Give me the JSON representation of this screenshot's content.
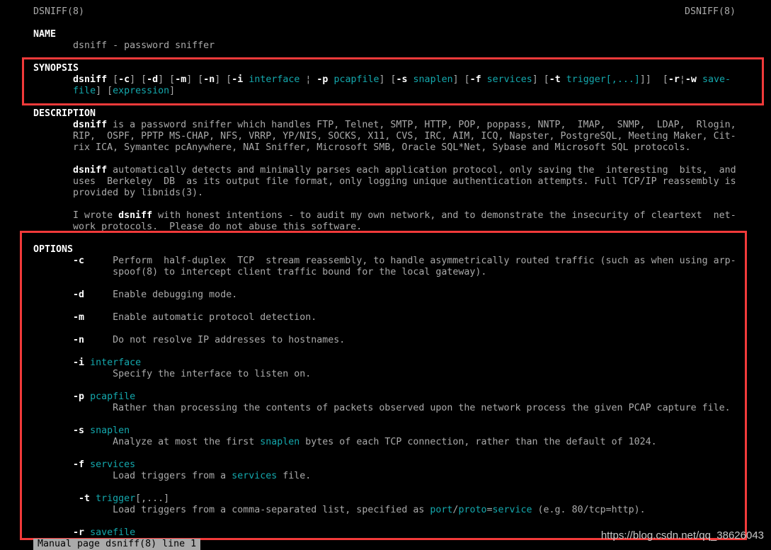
{
  "header": {
    "left": "DSNIFF(8)",
    "right": "DSNIFF(8)"
  },
  "colors": {
    "bold": "#ffffff",
    "normal": "#aaaaaa",
    "underline_cyan": "#14a8ad",
    "highlight_box": "#f23a3a",
    "status_bg": "#aaaaaa"
  },
  "lines": [
    [],
    [
      [
        "b",
        "NAME"
      ]
    ],
    [
      [
        "n",
        "       dsniff - password sniffer"
      ]
    ],
    [],
    [
      [
        "b",
        "SYNOPSIS"
      ]
    ],
    [
      [
        "b",
        "       dsniff"
      ],
      [
        "n",
        " ["
      ],
      [
        "b",
        "-c"
      ],
      [
        "n",
        "] ["
      ],
      [
        "b",
        "-d"
      ],
      [
        "n",
        "] ["
      ],
      [
        "b",
        "-m"
      ],
      [
        "n",
        "] ["
      ],
      [
        "b",
        "-n"
      ],
      [
        "n",
        "] ["
      ],
      [
        "b",
        "-i"
      ],
      [
        "n",
        " "
      ],
      [
        "c",
        "interface"
      ],
      [
        "n",
        " ¦ "
      ],
      [
        "b",
        "-p"
      ],
      [
        "n",
        " "
      ],
      [
        "c",
        "pcapfile"
      ],
      [
        "n",
        "] ["
      ],
      [
        "b",
        "-s"
      ],
      [
        "n",
        " "
      ],
      [
        "c",
        "snaplen"
      ],
      [
        "n",
        "] ["
      ],
      [
        "b",
        "-f"
      ],
      [
        "n",
        " "
      ],
      [
        "c",
        "services"
      ],
      [
        "n",
        "] ["
      ],
      [
        "b",
        "-t"
      ],
      [
        "n",
        " "
      ],
      [
        "c",
        "trigger[,...]"
      ],
      [
        "n",
        "]]  ["
      ],
      [
        "b",
        "-r"
      ],
      [
        "n",
        "¦"
      ],
      [
        "b",
        "-w"
      ],
      [
        "n",
        " "
      ],
      [
        "c",
        "save-"
      ]
    ],
    [
      [
        "n",
        "       "
      ],
      [
        "c",
        "file"
      ],
      [
        "n",
        "] ["
      ],
      [
        "c",
        "expression"
      ],
      [
        "n",
        "]"
      ]
    ],
    [],
    [
      [
        "b",
        "DESCRIPTION"
      ]
    ],
    [
      [
        "b",
        "       dsniff"
      ],
      [
        "n",
        " is a password sniffer which handles FTP, Telnet, SMTP, HTTP, POP, poppass, NNTP,  IMAP,  SNMP,  LDAP,  Rlogin,"
      ]
    ],
    [
      [
        "n",
        "       RIP,  OSPF, PPTP MS-CHAP, NFS, VRRP, YP/NIS, SOCKS, X11, CVS, IRC, AIM, ICQ, Napster, PostgreSQL, Meeting Maker, Cit-"
      ]
    ],
    [
      [
        "n",
        "       rix ICA, Symantec pcAnywhere, NAI Sniffer, Microsoft SMB, Oracle SQL*Net, Sybase and Microsoft SQL protocols."
      ]
    ],
    [],
    [
      [
        "b",
        "       dsniff"
      ],
      [
        "n",
        " automatically detects and minimally parses each application protocol, only saving the  interesting  bits,  and"
      ]
    ],
    [
      [
        "n",
        "       uses  Berkeley  DB  as its output file format, only logging unique authentication attempts. Full TCP/IP reassembly is"
      ]
    ],
    [
      [
        "n",
        "       provided by libnids(3)."
      ]
    ],
    [],
    [
      [
        "n",
        "       I wrote "
      ],
      [
        "b",
        "dsniff"
      ],
      [
        "n",
        " with honest intentions - to audit my own network, and to demonstrate the insecurity of cleartext  net-"
      ]
    ],
    [
      [
        "n",
        "       work protocols.  Please do not abuse this software."
      ]
    ],
    [],
    [
      [
        "b",
        "OPTIONS"
      ]
    ],
    [
      [
        "b",
        "       -c"
      ],
      [
        "n",
        "     Perform  half-duplex  TCP  stream reassembly, to handle asymmetrically routed traffic (such as when using arp-"
      ]
    ],
    [
      [
        "n",
        "              spoof(8) to intercept client traffic bound for the local gateway)."
      ]
    ],
    [],
    [
      [
        "b",
        "       -d"
      ],
      [
        "n",
        "     Enable debugging mode."
      ]
    ],
    [],
    [
      [
        "b",
        "       -m"
      ],
      [
        "n",
        "     Enable automatic protocol detection."
      ]
    ],
    [],
    [
      [
        "b",
        "       -n"
      ],
      [
        "n",
        "     Do not resolve IP addresses to hostnames."
      ]
    ],
    [],
    [
      [
        "b",
        "       -i"
      ],
      [
        "n",
        " "
      ],
      [
        "c",
        "interface"
      ]
    ],
    [
      [
        "n",
        "              Specify the interface to listen on."
      ]
    ],
    [],
    [
      [
        "b",
        "       -p"
      ],
      [
        "n",
        " "
      ],
      [
        "c",
        "pcapfile"
      ]
    ],
    [
      [
        "n",
        "              Rather than processing the contents of packets observed upon the network process the given PCAP capture file."
      ]
    ],
    [],
    [
      [
        "b",
        "       -s"
      ],
      [
        "n",
        " "
      ],
      [
        "c",
        "snaplen"
      ]
    ],
    [
      [
        "n",
        "              Analyze at most the first "
      ],
      [
        "c",
        "snaplen"
      ],
      [
        "n",
        " bytes of each TCP connection, rather than the default of 1024."
      ]
    ],
    [],
    [
      [
        "b",
        "       -f"
      ],
      [
        "n",
        " "
      ],
      [
        "c",
        "services"
      ]
    ],
    [
      [
        "n",
        "              Load triggers from a "
      ],
      [
        "c",
        "services"
      ],
      [
        "n",
        " file."
      ]
    ],
    [],
    [
      [
        "b",
        "        -t"
      ],
      [
        "n",
        " "
      ],
      [
        "c",
        "trigger"
      ],
      [
        "n",
        "[,...]"
      ]
    ],
    [
      [
        "n",
        "              Load triggers from a comma-separated list, specified as "
      ],
      [
        "c",
        "port"
      ],
      [
        "n",
        "/"
      ],
      [
        "c",
        "proto"
      ],
      [
        "n",
        "="
      ],
      [
        "c",
        "service"
      ],
      [
        "n",
        " (e.g. 80/tcp=http)."
      ]
    ],
    [],
    [
      [
        "b",
        "       -r"
      ],
      [
        "n",
        " "
      ],
      [
        "c",
        "savefile"
      ]
    ]
  ],
  "status_bar": "Manual page dsniff(8) line 1",
  "watermark": "https://blog.csdn.net/qq_38626043"
}
